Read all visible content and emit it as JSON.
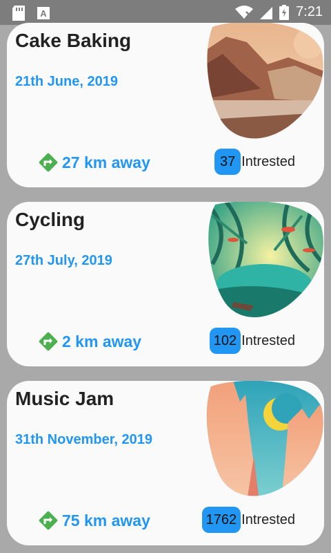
{
  "status_bar": {
    "time": "7:21",
    "left_icons": [
      "sd-card-icon",
      "a-notification-icon"
    ],
    "right_icons": [
      "wifi-icon",
      "signal-icon",
      "battery-icon"
    ]
  },
  "events": [
    {
      "title": "Cake Baking",
      "date": "21th June, 2019",
      "distance": "27 km away",
      "count": "37",
      "interest_label": "Intrested",
      "image": "mountain-lake-illustration"
    },
    {
      "title": "Cycling",
      "date": "27th July, 2019",
      "distance": "2 km away",
      "count": "102",
      "interest_label": "Intrested",
      "image": "forest-river-illustration"
    },
    {
      "title": "Music Jam",
      "date": "31th November, 2019",
      "distance": "75 km away",
      "count": "1762",
      "interest_label": "Intrested",
      "image": "canyon-moon-illustration"
    }
  ],
  "colors": {
    "accent": "#2196f3",
    "direction_icon": "#4caf50",
    "background": "#a9a9a9",
    "card": "#fafafa"
  }
}
